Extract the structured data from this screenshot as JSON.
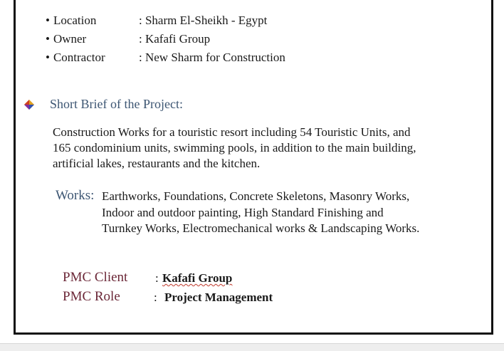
{
  "project_info": {
    "location": {
      "key": "Location",
      "value": ": Sharm El-Sheikh - Egypt"
    },
    "owner": {
      "key": "Owner",
      "value": ": Kafafi Group"
    },
    "contractor": {
      "key": "Contractor",
      "value": ": New Sharm for Construction"
    }
  },
  "bullet_char": "•",
  "section": {
    "heading": "Short Brief of the Project:",
    "brief_lines": [
      "Construction Works for a touristic resort including 54 Touristic Units, and",
      "165 condominium units, swimming pools, in addition to the main building,",
      "artificial lakes, restaurants and the kitchen."
    ]
  },
  "works": {
    "label": "Works:",
    "lines": [
      "Earthworks, Foundations, Concrete Skeletons, Masonry Works,",
      "Indoor and outdoor painting, High Standard Finishing and",
      "Turnkey Works, Electromechanical works & Landscaping Works."
    ]
  },
  "pmc": {
    "client_label": "PMC Client",
    "client_colon": ":",
    "client_value": "Kafafi Group",
    "role_label": "PMC Role",
    "role_colon": ":",
    "role_value": "Project Management"
  },
  "colors": {
    "heading": "#3d5673",
    "pmc_label": "#6b2737",
    "spellcheck_underline": "#c0392b"
  },
  "icons": {
    "section_bullet": "diamond-bullet-icon"
  }
}
